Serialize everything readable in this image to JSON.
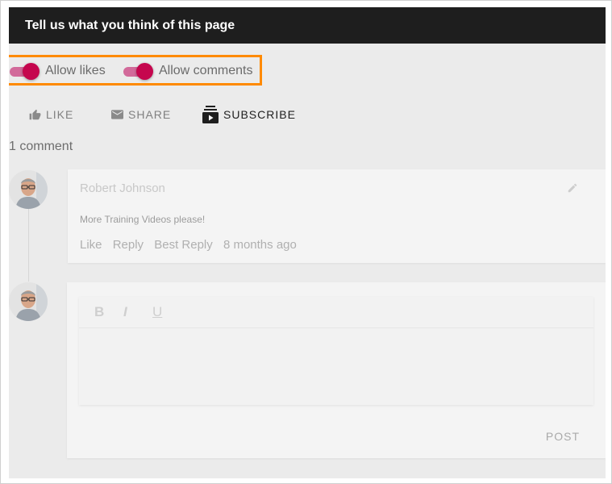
{
  "header": {
    "title": "Tell us what you think of this page"
  },
  "toggles": [
    {
      "label": "Allow likes",
      "on": true
    },
    {
      "label": "Allow comments",
      "on": true
    }
  ],
  "actions": [
    {
      "label": "LIKE",
      "icon": "thumbs-up-icon"
    },
    {
      "label": "SHARE",
      "icon": "envelope-icon"
    },
    {
      "label": "SUBSCRIBE",
      "icon": "subscriptions-icon"
    }
  ],
  "comments": {
    "count_label": "1 comment",
    "items": [
      {
        "author": "Robert Johnson",
        "text": "More Training Videos please!",
        "links": [
          "Like",
          "Reply",
          "Best Reply"
        ],
        "time": "8 months ago"
      }
    ]
  },
  "editor": {
    "toolbar": [
      "B",
      "I",
      "U"
    ],
    "post_label": "POST"
  },
  "colors": {
    "header_bg": "#1e1e1e",
    "toggle_accent": "#c5064e",
    "highlight_border": "#ff8a00"
  }
}
